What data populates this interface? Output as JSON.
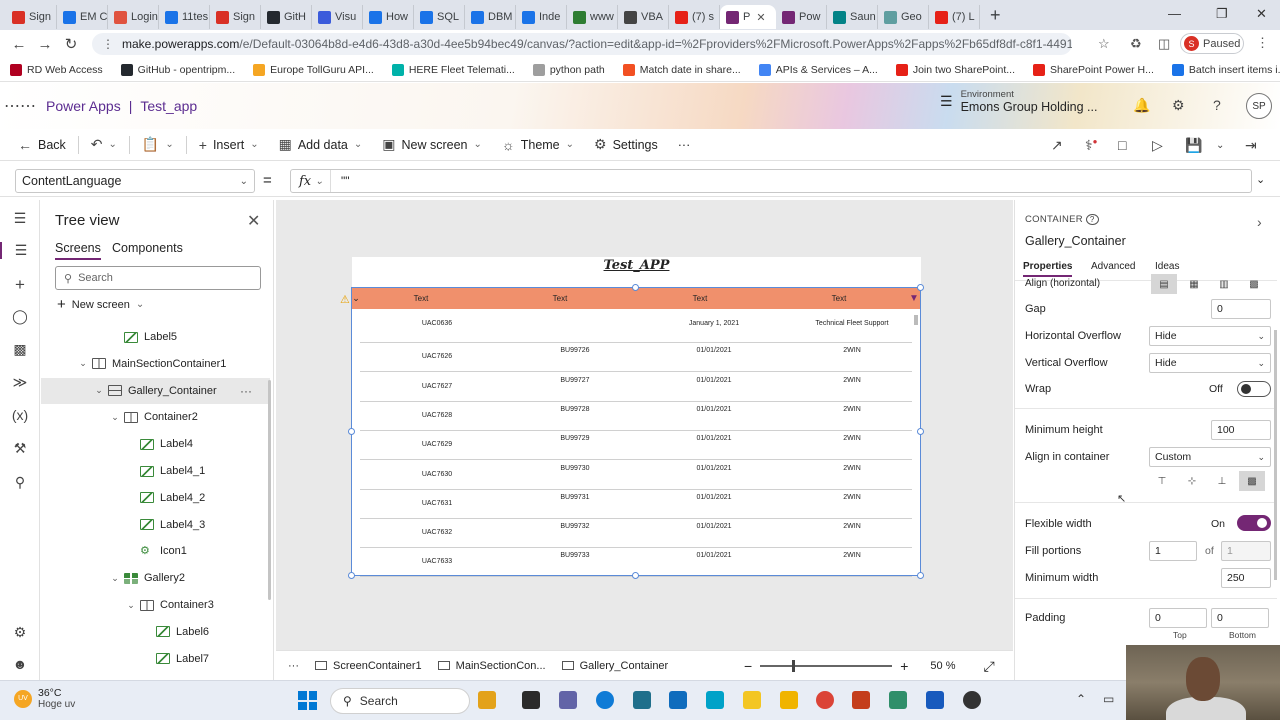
{
  "browser": {
    "tabs": [
      {
        "label": "Sign",
        "color": "#d93025"
      },
      {
        "label": "EM C",
        "color": "#1a73e8"
      },
      {
        "label": "Login",
        "color": "#e0533f"
      },
      {
        "label": "11tes",
        "color": "#1a73e8"
      },
      {
        "label": "Sign",
        "color": "#d93025"
      },
      {
        "label": "GitH",
        "color": "#24292f"
      },
      {
        "label": "Visu",
        "color": "#3b5bdb"
      },
      {
        "label": "How",
        "color": "#1a73e8"
      },
      {
        "label": "SQL",
        "color": "#1a73e8"
      },
      {
        "label": "DBM",
        "color": "#1a73e8"
      },
      {
        "label": "Inde",
        "color": "#1a73e8"
      },
      {
        "label": "www",
        "color": "#2e7d32"
      },
      {
        "label": "VBA",
        "color": "#444444"
      },
      {
        "label": "(7) s",
        "color": "#e62117"
      },
      {
        "label": "P",
        "color": "#742774",
        "active": true
      },
      {
        "label": "Pow",
        "color": "#742774"
      },
      {
        "label": "Saun",
        "color": "#038387"
      },
      {
        "label": "Geo",
        "color": "#5f9ea0"
      },
      {
        "label": "(7) L",
        "color": "#e62117"
      }
    ],
    "new_tab": "+",
    "url_host": "make.powerapps.com",
    "url_path": "/e/Default-03064b8d-e4d6-43d8-a30d-4ee5b94bec49/canvas/?action=edit&app-id=%2Fproviders%2FMicrosoft.PowerApps%2Fapps%2Fb65df8df-c8f1-4491-8...",
    "profile_letter": "S",
    "profile_status": "Paused",
    "bookmarks": [
      {
        "label": "RD Web Access",
        "color": "#b00020"
      },
      {
        "label": "GitHub - opentripm...",
        "color": "#24292f"
      },
      {
        "label": "Europe TollGuru API...",
        "color": "#f5a623"
      },
      {
        "label": "HERE Fleet Telemati...",
        "color": "#00b2a9"
      },
      {
        "label": "python path",
        "color": "#9e9e9e"
      },
      {
        "label": "Match date in share...",
        "color": "#f25022"
      },
      {
        "label": "APIs & Services – A...",
        "color": "#4285f4"
      },
      {
        "label": "Join two SharePoint...",
        "color": "#e62117"
      },
      {
        "label": "SharePoint Power H...",
        "color": "#e62117"
      },
      {
        "label": "Batch insert items i...",
        "color": "#1a73e8"
      }
    ]
  },
  "app": {
    "product": "Power Apps",
    "divider": "|",
    "app_name": "Test_app",
    "env_label": "Environment",
    "env_name": "Emons Group Holding ...",
    "user_initials": "SP",
    "accent": "#742774"
  },
  "commands": {
    "back": "Back",
    "insert": "Insert",
    "add_data": "Add data",
    "new_screen": "New screen",
    "theme": "Theme",
    "settings": "Settings",
    "more": "···"
  },
  "formula": {
    "property": "ContentLanguage",
    "equals": "=",
    "fx": "fx",
    "value": "\"\""
  },
  "tree": {
    "title": "Tree view",
    "tab_screens": "Screens",
    "tab_components": "Components",
    "search_placeholder": "Search",
    "new_screen": "New screen",
    "nodes": [
      {
        "label": "Label5",
        "indent": 4,
        "icon": "lbl",
        "caret": ""
      },
      {
        "label": "MainSectionContainer1",
        "indent": 2,
        "icon": "hcont",
        "caret": "⌄"
      },
      {
        "label": "Gallery_Container",
        "indent": 3,
        "icon": "vcont",
        "caret": "⌄",
        "selected": true
      },
      {
        "label": "Container2",
        "indent": 4,
        "icon": "hcont",
        "caret": "⌄"
      },
      {
        "label": "Label4",
        "indent": 5,
        "icon": "lbl",
        "caret": ""
      },
      {
        "label": "Label4_1",
        "indent": 5,
        "icon": "lbl",
        "caret": ""
      },
      {
        "label": "Label4_2",
        "indent": 5,
        "icon": "lbl",
        "caret": ""
      },
      {
        "label": "Label4_3",
        "indent": 5,
        "icon": "lbl",
        "caret": ""
      },
      {
        "label": "Icon1",
        "indent": 5,
        "icon": "icn",
        "caret": ""
      },
      {
        "label": "Gallery2",
        "indent": 4,
        "icon": "gal",
        "caret": "⌄"
      },
      {
        "label": "Container3",
        "indent": 5,
        "icon": "hcont",
        "caret": "⌄"
      },
      {
        "label": "Label6",
        "indent": 6,
        "icon": "lbl",
        "caret": ""
      },
      {
        "label": "Label7",
        "indent": 6,
        "icon": "lbl",
        "caret": ""
      }
    ]
  },
  "canvas": {
    "app_title": "Test_APP",
    "header_color": "#f0906c",
    "headers": [
      "Text",
      "Text",
      "Text",
      "Text"
    ],
    "rows": [
      [
        "UAC0636",
        "",
        "January 1, 2021",
        "Technical Fleet Support"
      ],
      [
        "UAC7626",
        "BU99726",
        "01/01/2021",
        "2WIN"
      ],
      [
        "UAC7627",
        "BU99727",
        "01/01/2021",
        "2WIN"
      ],
      [
        "UAC7628",
        "BU99728",
        "01/01/2021",
        "2WIN"
      ],
      [
        "UAC7629",
        "BU99729",
        "01/01/2021",
        "2WIN"
      ],
      [
        "UAC7630",
        "BU99730",
        "01/01/2021",
        "2WIN"
      ],
      [
        "UAC7631",
        "BU99731",
        "01/01/2021",
        "2WIN"
      ],
      [
        "UAC7632",
        "BU99732",
        "01/01/2021",
        "2WIN"
      ],
      [
        "UAC7633",
        "BU99733",
        "01/01/2021",
        "2WIN"
      ]
    ]
  },
  "breadcrumbs": {
    "more": "···",
    "items": [
      "ScreenContainer1",
      "MainSectionCon...",
      "Gallery_Container"
    ],
    "zoom_minus": "−",
    "zoom_plus": "+",
    "zoom_level": "50",
    "zoom_unit": "%"
  },
  "properties": {
    "kind": "CONTAINER",
    "name": "Gallery_Container",
    "tab_properties": "Properties",
    "tab_advanced": "Advanced",
    "tab_ideas": "Ideas",
    "align_horizontal": "Align (horizontal)",
    "gap_label": "Gap",
    "gap_value": "0",
    "hoverflow_label": "Horizontal Overflow",
    "hoverflow_value": "Hide",
    "voverflow_label": "Vertical Overflow",
    "voverflow_value": "Hide",
    "wrap_label": "Wrap",
    "wrap_state": "Off",
    "minheight_label": "Minimum height",
    "minheight_value": "100",
    "align_container_label": "Align in container",
    "align_container_value": "Custom",
    "flexwidth_label": "Flexible width",
    "flexwidth_state": "On",
    "fillportions_label": "Fill portions",
    "fillportions_value": "1",
    "fillportions_of": "of",
    "fillportions_total": "1",
    "minwidth_label": "Minimum width",
    "minwidth_value": "250",
    "padding_label": "Padding",
    "padding_top": "0",
    "padding_bottom": "0",
    "padding_top_label": "Top",
    "padding_bottom_label": "Bottom"
  },
  "taskbar": {
    "temperature": "36°C",
    "weather_text": "Hoge uv",
    "weather_badge": "UV",
    "search": "Search"
  }
}
